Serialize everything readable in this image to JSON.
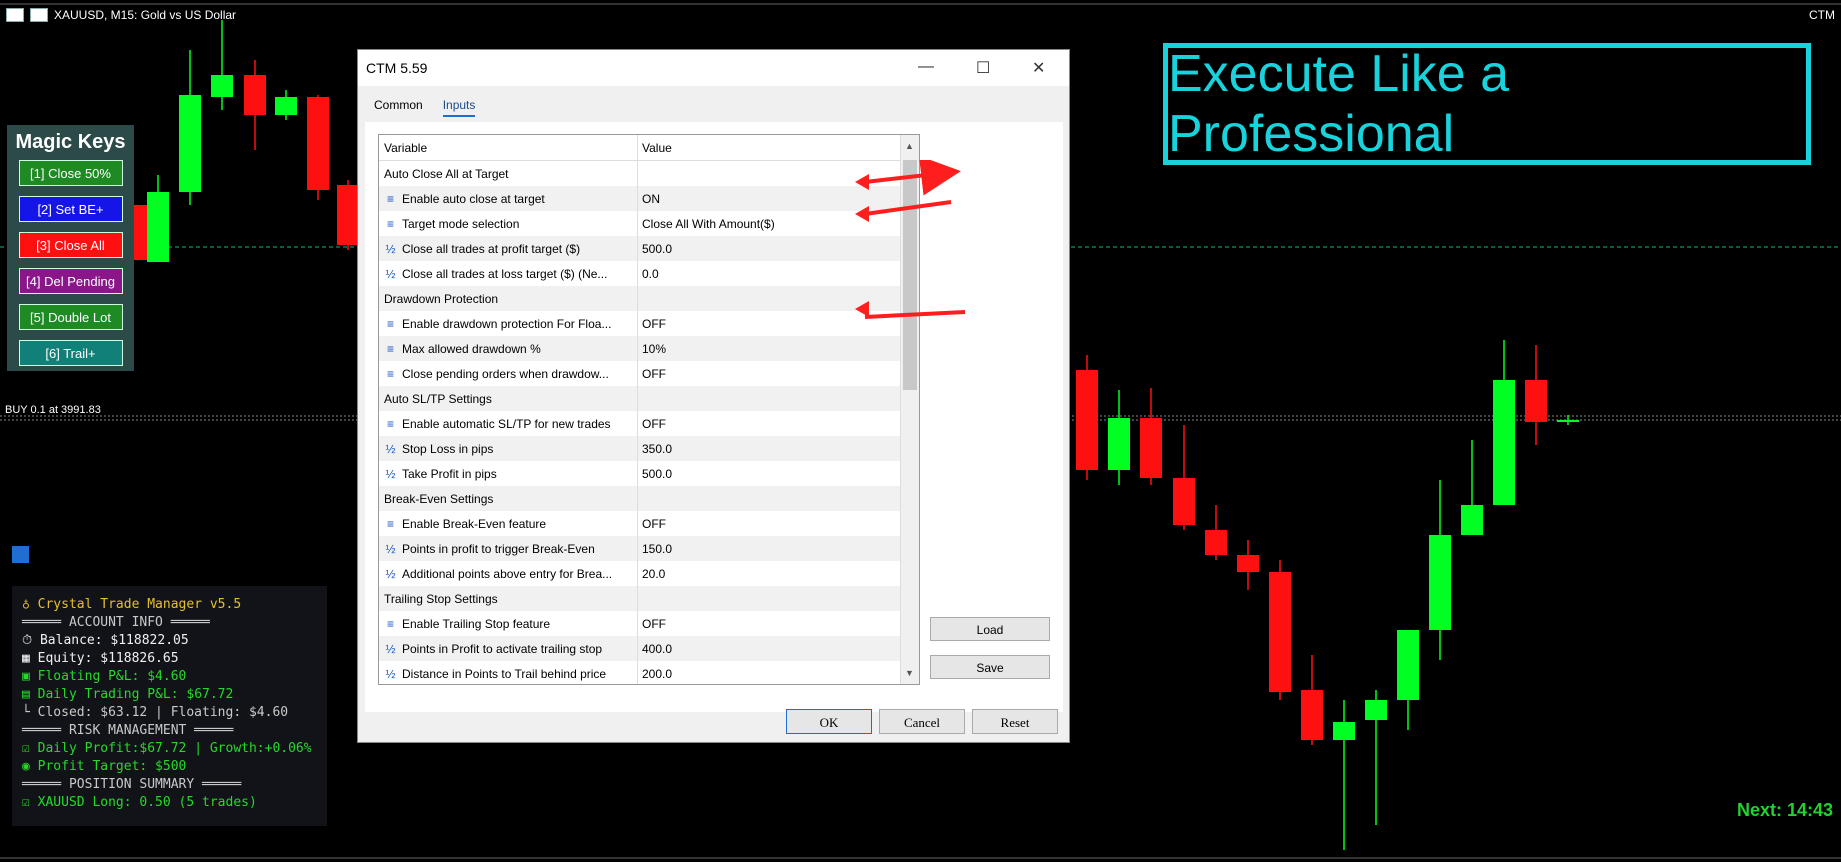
{
  "header": {
    "symbol_title": "XAUUSD, M15:  Gold vs US Dollar",
    "right_label": "CTM"
  },
  "promo": {
    "text": "Execute Like a Professional"
  },
  "magic_keys": {
    "title": "Magic Keys",
    "buttons": [
      {
        "label": "[1] Close 50%",
        "color": "#1e8a23"
      },
      {
        "label": "[2] Set BE+",
        "color": "#1515e8"
      },
      {
        "label": "[3] Close All",
        "color": "#ff1010"
      },
      {
        "label": "[4] Del Pending",
        "color": "#8a168a"
      },
      {
        "label": "[5] Double Lot",
        "color": "#1e8a23"
      },
      {
        "label": "[6] Trail+",
        "color": "#108078"
      }
    ]
  },
  "chart_overlay": {
    "buy_label": "BUY 0.1 at 3991.83"
  },
  "info_panel": {
    "title": "Crystal Trade Manager v5.5",
    "account_header": "═════ ACCOUNT INFO ═════",
    "balance": "Balance: $118822.05",
    "equity": "Equity: $118826.65",
    "floating": "Floating P&L: $4.60",
    "daily": "Daily Trading P&L: $67.72",
    "closed": "└ Closed: $63.12 | Floating: $4.60",
    "risk_header": "═════ RISK MANAGEMENT ═════",
    "daily_profit": "Daily Profit:$67.72 | Growth:+0.06%",
    "profit_target": "Profit Target: $500",
    "position_header": "═════ POSITION SUMMARY ═════",
    "position": "XAUUSD Long: 0.50 (5 trades)"
  },
  "next_label": "Next: 14:43",
  "dialog": {
    "title": "CTM 5.59",
    "tabs": [
      "Common",
      "Inputs"
    ],
    "col_variable": "Variable",
    "col_value": "Value",
    "rows": [
      {
        "type": "cat",
        "label": "Auto Close All at Target"
      },
      {
        "type": "bool",
        "label": "Enable auto close at target",
        "value": "ON"
      },
      {
        "type": "bool",
        "label": "Target mode selection",
        "value": "Close All With Amount($)"
      },
      {
        "type": "num",
        "label": "Close all trades at profit target ($)",
        "value": "500.0"
      },
      {
        "type": "num",
        "label": "Close all trades at loss target ($) (Ne...",
        "value": "0.0"
      },
      {
        "type": "cat",
        "label": "Drawdown Protection"
      },
      {
        "type": "bool",
        "label": "Enable drawdown protection For Floa...",
        "value": "OFF"
      },
      {
        "type": "bool",
        "label": "Max allowed drawdown %",
        "value": "10%"
      },
      {
        "type": "bool",
        "label": "Close pending orders when drawdow...",
        "value": "OFF"
      },
      {
        "type": "cat",
        "label": "Auto SL/TP Settings"
      },
      {
        "type": "bool",
        "label": "Enable automatic SL/TP for new trades",
        "value": "OFF"
      },
      {
        "type": "num",
        "label": "Stop Loss in pips",
        "value": "350.0"
      },
      {
        "type": "num",
        "label": "Take Profit in pips",
        "value": "500.0"
      },
      {
        "type": "cat",
        "label": "Break-Even Settings"
      },
      {
        "type": "bool",
        "label": "Enable Break-Even feature",
        "value": "OFF"
      },
      {
        "type": "num",
        "label": "Points in profit to trigger Break-Even",
        "value": "150.0"
      },
      {
        "type": "num",
        "label": "Additional points above entry for Brea...",
        "value": "20.0"
      },
      {
        "type": "cat",
        "label": "Trailing Stop Settings"
      },
      {
        "type": "bool",
        "label": "Enable Trailing Stop feature",
        "value": "OFF"
      },
      {
        "type": "num",
        "label": "Points in Profit to activate trailing stop",
        "value": "400.0"
      },
      {
        "type": "num",
        "label": "Distance in Points to Trail behind price",
        "value": "200.0"
      }
    ],
    "load": "Load",
    "save": "Save",
    "ok": "OK",
    "cancel": "Cancel",
    "reset": "Reset"
  },
  "colors": {
    "bull": "#00ff22",
    "bear": "#ff1010",
    "accent": "#19d3dc"
  }
}
